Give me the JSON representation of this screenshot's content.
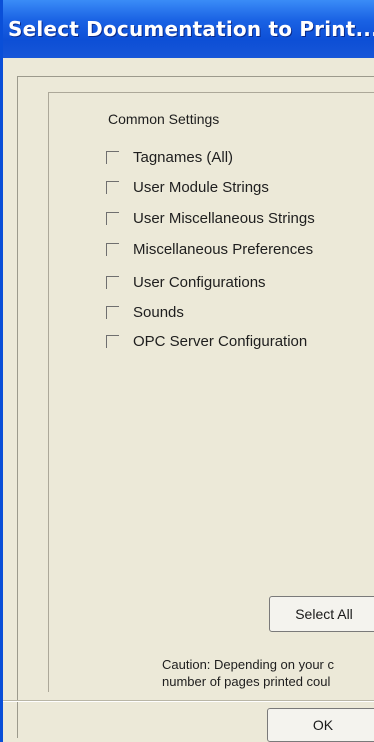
{
  "window": {
    "title": "Select Documentation to Print..."
  },
  "settings": {
    "section_label": "Common Settings",
    "options": [
      {
        "label": "Tagnames (All)",
        "checked": false
      },
      {
        "label": "User Module Strings",
        "checked": false
      },
      {
        "label": "User Miscellaneous Strings",
        "checked": false
      },
      {
        "label": "Miscellaneous Preferences",
        "checked": false
      },
      {
        "label": "User Configurations",
        "checked": false
      },
      {
        "label": "Sounds",
        "checked": false
      },
      {
        "label": "OPC Server Configuration",
        "checked": false
      }
    ]
  },
  "buttons": {
    "select_all": "Select All",
    "ok": "OK"
  },
  "caution": {
    "line1": "Caution: Depending on your c",
    "line2": "number of pages printed coul"
  },
  "colors": {
    "titlebar": "#0d4fd6",
    "dialog_bg": "#ece9d8"
  }
}
